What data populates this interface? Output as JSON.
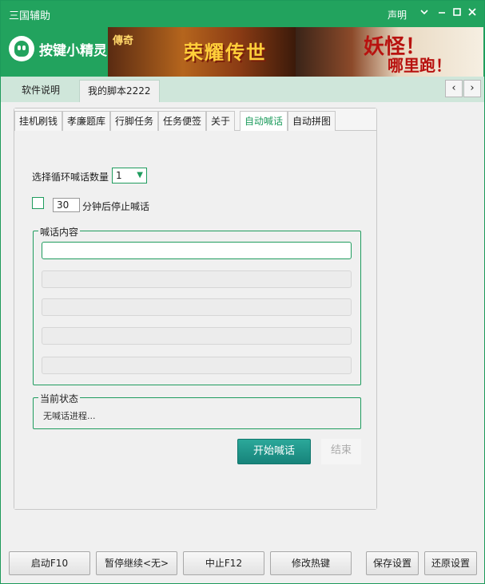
{
  "window": {
    "title": "三国辅助",
    "declare": "声明"
  },
  "brand": {
    "name": "按键小精灵",
    "banner_left_small": "傳奇",
    "banner_left_text": "荣耀传世",
    "banner_right_text": "妖怪！",
    "banner_right_sub": "哪里跑！"
  },
  "top_tabs": [
    "软件说明",
    "我的脚本2222"
  ],
  "inner_tabs": [
    "挂机刷钱",
    "孝廉题库",
    "行脚任务",
    "任务便签",
    "关于",
    "自动喊话",
    "自动拼图"
  ],
  "settings": {
    "loop_label": "选择循环喊话数量",
    "loop_value": "1",
    "stop_minutes": "30",
    "stop_label": "分钟后停止喊话"
  },
  "shout_group": {
    "legend": "喊话内容",
    "fields": [
      "",
      "",
      "",
      "",
      ""
    ]
  },
  "status_group": {
    "legend": "当前状态",
    "text": "无喊话进程..."
  },
  "actions": {
    "start": "开始喊话",
    "end": "结束"
  },
  "bottom_buttons": [
    "启动F10",
    "暂停继续<无>",
    "中止F12",
    "修改热键",
    "保存设置",
    "还原设置"
  ],
  "colors": {
    "brand_green": "#22a35e",
    "accent_green": "#1f9c5e",
    "start_button": "#1f9488"
  }
}
